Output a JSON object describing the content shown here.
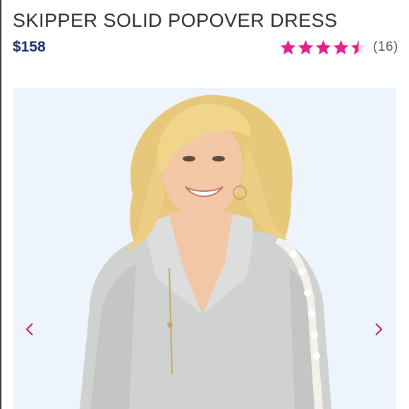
{
  "product": {
    "title": "SKIPPER SOLID POPOVER DRESS",
    "price": "$158",
    "rating": {
      "value": 4.5,
      "max": 5,
      "count_label": "(16)",
      "star_color": "#e5208d",
      "empty_color": "#e6e6e6"
    }
  },
  "gallery": {
    "background": "#eef4fb",
    "image_alt": "Model wearing grey quarter-zip popover with lace sleeve trim",
    "prev_icon": "chevron-left-icon",
    "next_icon": "chevron-right-icon",
    "arrow_color": "#c2185b"
  },
  "colors": {
    "title": "#2b2b2b",
    "price": "#1d2a6b"
  }
}
